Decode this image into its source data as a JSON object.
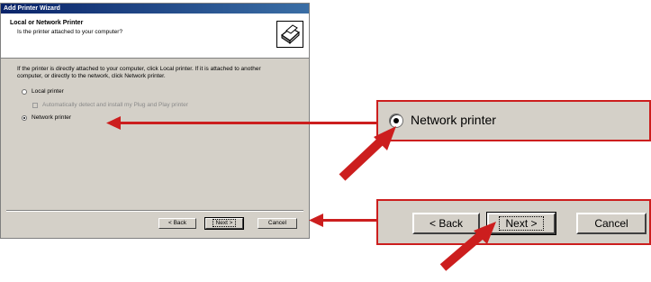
{
  "window": {
    "title": "Add Printer Wizard"
  },
  "header": {
    "title": "Local or Network Printer",
    "subtitle": "Is the printer attached to your computer?",
    "icon": "printer-icon"
  },
  "body": {
    "instructions": "If the printer is directly attached to your computer, click Local printer. If it is attached to another computer, or directly to the network, click Network printer.",
    "options": {
      "local_printer": "Local printer",
      "auto_detect": "Automatically detect and install my Plug and Play printer",
      "network_printer": "Network printer"
    },
    "selected": "network_printer"
  },
  "buttons": {
    "back": "< Back",
    "next": "Next >",
    "cancel": "Cancel"
  },
  "callouts": {
    "network_printer": "Network printer",
    "back": "< Back",
    "next": "Next >",
    "cancel": "Cancel"
  },
  "colors": {
    "accent_red": "#cc1e1e",
    "titlebar": "#0a246a",
    "dialog_bg": "#d4d0c8"
  }
}
